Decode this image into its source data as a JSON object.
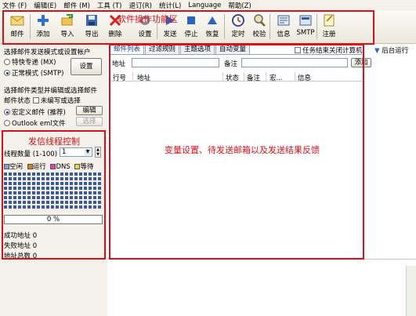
{
  "menu": [
    "文件 (F)",
    "编辑(E)",
    "邮件 (M)",
    "工具 (T)",
    "退订(R)",
    "统计(L)",
    "Language",
    "帮助(Z)"
  ],
  "toolbar": {
    "buttons": [
      {
        "label": "邮件",
        "icon": "envelope-icon"
      },
      {
        "label": "添加",
        "icon": "plus-icon"
      },
      {
        "label": "导入",
        "icon": "import-icon"
      },
      {
        "label": "导出",
        "icon": "save-icon"
      },
      {
        "label": "删除",
        "icon": "delete-icon"
      },
      {
        "label": "设置",
        "icon": "gear-icon"
      },
      {
        "label": "发送",
        "icon": "send-icon"
      },
      {
        "label": "停止",
        "icon": "stop-icon"
      },
      {
        "label": "恢复",
        "icon": "resume-icon"
      },
      {
        "label": "定时",
        "icon": "clock-icon"
      },
      {
        "label": "校验",
        "icon": "magnifier-icon"
      },
      {
        "label": "信息",
        "icon": "info-icon"
      },
      {
        "label": "SMTP",
        "icon": "smtp-icon"
      },
      {
        "label": "注册",
        "icon": "register-icon"
      }
    ]
  },
  "annotations": {
    "toolbar": "软件操作功能区",
    "threads": "发信线程控制",
    "main": "变量设置、待发送邮箱以及发送结果反馈"
  },
  "left": {
    "send_mode_title": "选择邮件发送模式或设置帐户",
    "mode_special": "特快专递 (MX)",
    "mode_normal": "正常模式 (SMTP)",
    "settings_button": "设置",
    "mail_type_title": "选择邮件类型并编辑或选择邮件",
    "mail_status_label": "邮件状态",
    "mail_status_value": "未编写或选择",
    "custom_mail": "宏定义邮件 (推荐)",
    "edit_button": "编辑",
    "outlook_file": "Outlook eml文件",
    "choose_button": "选择",
    "thread_count_label": "线程数量 (1-100)",
    "thread_count_value": "1",
    "legend": [
      {
        "label": "空闲",
        "color": "#7da0d8"
      },
      {
        "label": "运行",
        "color": "#d8801a"
      },
      {
        "label": "DNS",
        "color": "#e040c0"
      },
      {
        "label": "等待",
        "color": "#e8d63a"
      }
    ],
    "progress_text": "0 %",
    "progress_value": 0,
    "stats": [
      {
        "label": "成功地址",
        "value": "0"
      },
      {
        "label": "失败地址",
        "value": "0"
      },
      {
        "label": "地址总数",
        "value": "0"
      }
    ]
  },
  "main": {
    "tabs": [
      "邮件列表",
      "过滤规则",
      "主题选项",
      "自动变量"
    ],
    "close_on_finish": "任务结束关闭计算机",
    "background_run": "后台运行",
    "address_label": "地址",
    "remark_label": "备注",
    "add_button": "添加",
    "columns": [
      "行号",
      "地址",
      "状态",
      "备注",
      "宏...",
      "信息"
    ]
  }
}
